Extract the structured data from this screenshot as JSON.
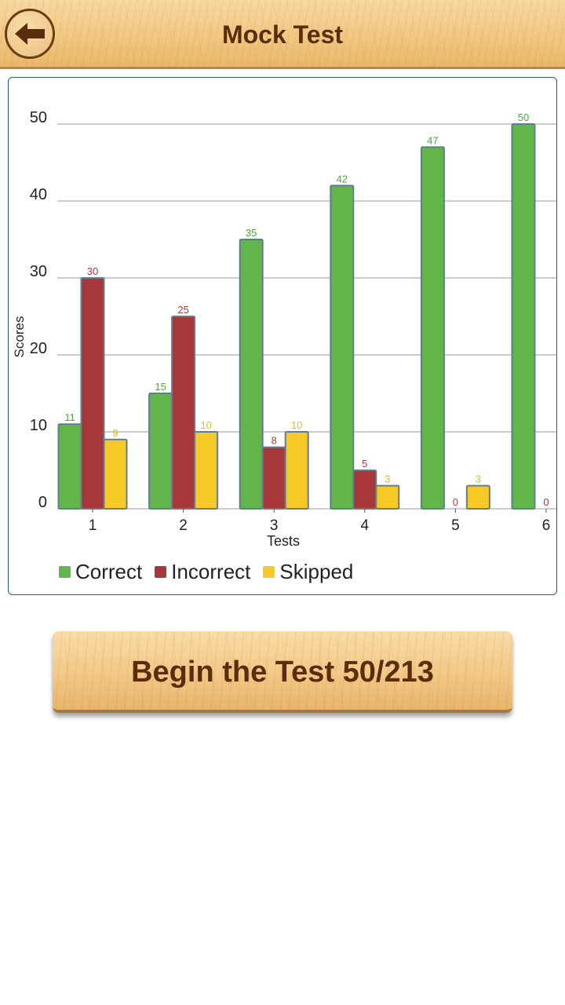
{
  "header": {
    "title": "Mock Test",
    "back_icon": "arrow-left-icon"
  },
  "chart_data": {
    "type": "bar",
    "categories": [
      "1",
      "2",
      "3",
      "4",
      "5",
      "6"
    ],
    "series": [
      {
        "name": "Correct",
        "color": "#62b54a",
        "label_color": "#4ca838",
        "values": [
          11,
          15,
          35,
          42,
          47,
          50
        ]
      },
      {
        "name": "Incorrect",
        "color": "#a8373a",
        "label_color": "#b03a3a",
        "values": [
          30,
          25,
          8,
          5,
          0,
          0
        ]
      },
      {
        "name": "Skipped",
        "color": "#f7c927",
        "label_color": "#e6b81c",
        "values": [
          9,
          10,
          10,
          3,
          3,
          null
        ]
      }
    ],
    "title": "",
    "xlabel": "Tests",
    "ylabel": "Scores",
    "ylim": [
      0,
      50
    ],
    "yticks": [
      0,
      10,
      20,
      30,
      40,
      50
    ],
    "grid": true,
    "legend_position": "bottom"
  },
  "begin_button": {
    "label": "Begin the Test 50/213"
  }
}
